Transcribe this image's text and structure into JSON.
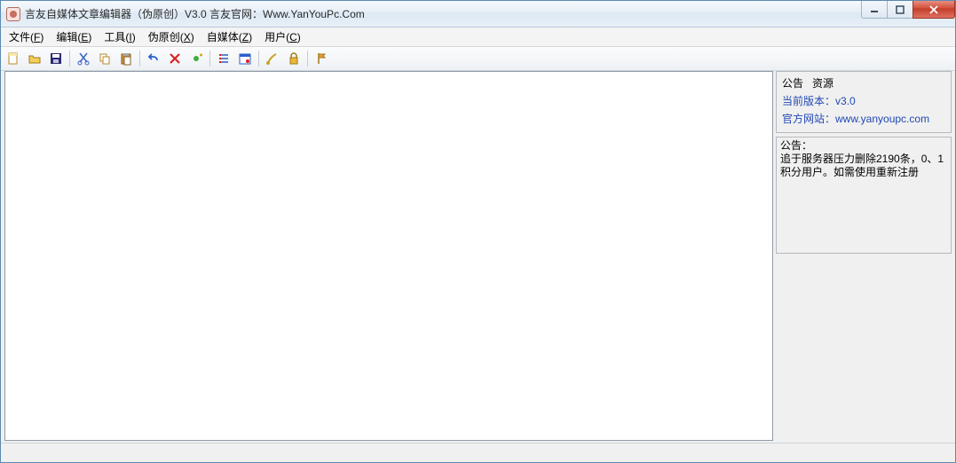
{
  "titlebar": {
    "title": "言友自媒体文章编辑器（伪原创）V3.0 言友官网：Www.YanYouPc.Com"
  },
  "menu": {
    "items": [
      {
        "label": "文件(",
        "hotkey": "F",
        "tail": ")"
      },
      {
        "label": "编辑(",
        "hotkey": "E",
        "tail": ")"
      },
      {
        "label": "工具(",
        "hotkey": "I",
        "tail": ")"
      },
      {
        "label": "伪原创(",
        "hotkey": "X",
        "tail": ")"
      },
      {
        "label": "自媒体(",
        "hotkey": "Z",
        "tail": ")"
      },
      {
        "label": "用户(",
        "hotkey": "C",
        "tail": ")"
      }
    ]
  },
  "toolbar": {
    "buttons": [
      {
        "name": "new-icon"
      },
      {
        "name": "open-icon"
      },
      {
        "name": "save-icon"
      },
      {
        "sep": true
      },
      {
        "name": "cut-icon"
      },
      {
        "name": "copy-icon"
      },
      {
        "name": "paste-icon"
      },
      {
        "sep": true
      },
      {
        "name": "undo-icon"
      },
      {
        "name": "delete-icon"
      },
      {
        "name": "add-icon"
      },
      {
        "sep": true
      },
      {
        "name": "list-icon"
      },
      {
        "name": "calendar-icon"
      },
      {
        "sep": true
      },
      {
        "name": "brush-icon"
      },
      {
        "name": "lock-icon"
      },
      {
        "sep": true
      },
      {
        "name": "flag-icon"
      }
    ]
  },
  "editor": {
    "value": ""
  },
  "side": {
    "tab1": "公告",
    "tab2": "资源",
    "version_label": "当前版本：",
    "version_value": "v3.0",
    "site_label": "官方网站：",
    "site_value": "www.yanyoupc.com",
    "notice_title": "公告：",
    "notice_body": "追于服务器压力删除2190条，0、1积分用户。如需使用重新注册"
  }
}
